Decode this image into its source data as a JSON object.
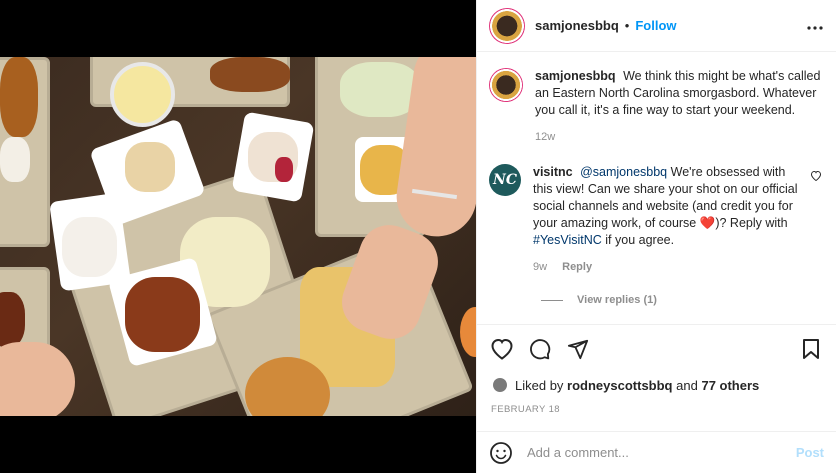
{
  "post": {
    "username": "samjonesbbq",
    "follow_label": "Follow",
    "separator": "•",
    "more_icon": "more-horizontal-icon"
  },
  "caption": {
    "username": "samjonesbbq",
    "text": "We think this might be what's called an Eastern North Carolina smorgasbord. Whatever you call it, it's a fine way to start your weekend.",
    "age": "12w"
  },
  "comment": {
    "avatar_text": "NC",
    "username": "visitnc",
    "mention": "@samjonesbbq",
    "text_before_heart": "We're obsessed with this view! Can we share your shot on our official social channels and website (and credit you for your amazing work, of course",
    "heart": "❤️",
    "text_after_heart": ")? Reply with",
    "hashtag": "#YesVisitNC",
    "text_end": "if you agree.",
    "age": "9w",
    "reply_label": "Reply",
    "view_replies": "View replies (1)"
  },
  "likes": {
    "prefix": "Liked by",
    "user": "rodneyscottsbbq",
    "suffix": "and",
    "others": "77 others"
  },
  "date": "FEBRUARY 18",
  "add_comment": {
    "placeholder": "Add a comment...",
    "post_label": "Post"
  },
  "colors": {
    "accent": "#0095f6",
    "post_disabled": "#b2dffc",
    "link": "#00376b",
    "muted": "#8e8e8e"
  }
}
